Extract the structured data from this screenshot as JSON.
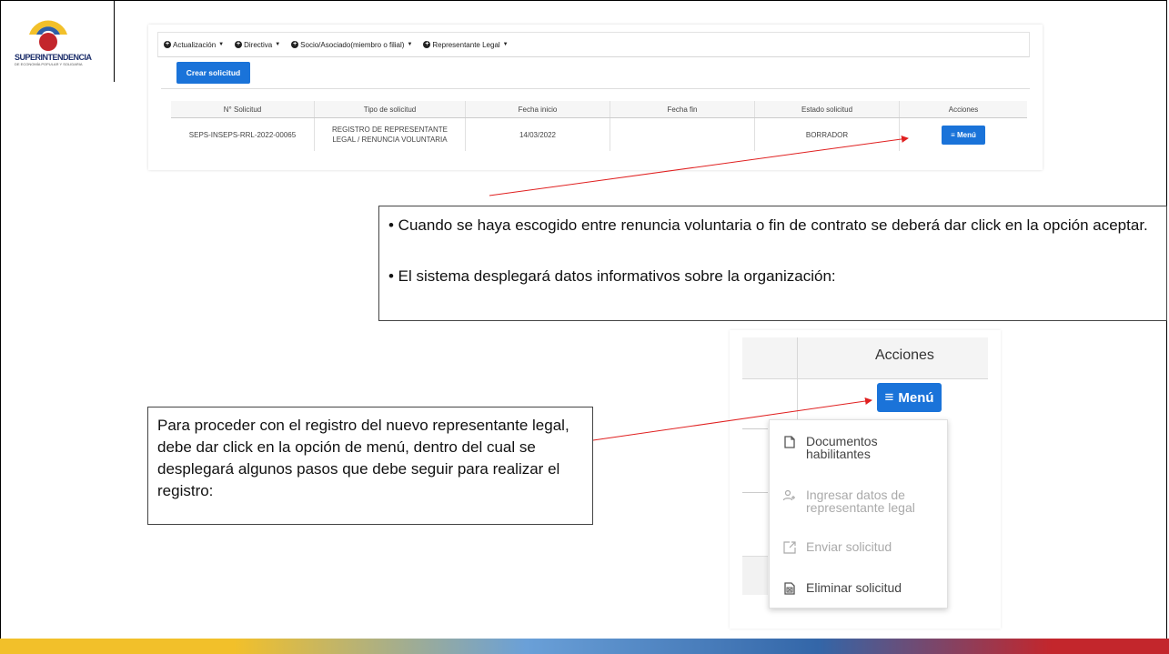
{
  "logo": {
    "text": "SUPERINTENDENCIA",
    "subtext": "DE ECONOMÍA POPULAR Y SOLIDARIA"
  },
  "top_screen": {
    "menu": [
      {
        "label": "Actualización"
      },
      {
        "label": "Directiva"
      },
      {
        "label": "Socio/Asociado(miembro o filial)"
      },
      {
        "label": "Representante Legal"
      }
    ],
    "crear_label": "Crear solicitud",
    "table": {
      "headers": [
        "N° Solicitud",
        "Tipo de solicitud",
        "Fecha inicio",
        "Fecha fin",
        "Estado solicitud",
        "Acciones"
      ],
      "row": {
        "numero": "SEPS-INSEPS-RRL-2022-00065",
        "tipo_line1": "REGISTRO DE REPRESENTANTE",
        "tipo_line2": "LEGAL / RENUNCIA VOLUNTARIA",
        "fecha_inicio": "14/03/2022",
        "fecha_fin": "",
        "estado": "BORRADOR",
        "accion": "≡ Menú"
      }
    }
  },
  "box1": {
    "p1": "• Cuando se haya escogido entre renuncia voluntaria o fin de contrato se deberá dar click en la opción aceptar.",
    "p2": "• El sistema desplegará datos informativos sobre la organización:"
  },
  "box2": {
    "text": "Para proceder con el registro del nuevo representante legal, debe dar click en la opción de menú, dentro del cual se desplegará algunos pasos que debe seguir para realizar el registro:"
  },
  "right_screen": {
    "acciones_label": "Acciones",
    "menu_label": "Menú",
    "dropdown": [
      {
        "line1": "Documentos",
        "line2": "habilitantes",
        "icon": "document-icon",
        "disabled": false
      },
      {
        "line1": "Ingresar datos de",
        "line2": "representante legal",
        "icon": "add-user-icon",
        "disabled": true
      },
      {
        "line1": "Enviar solicitud",
        "line2": "",
        "icon": "external-link-icon",
        "disabled": true
      },
      {
        "line1": "Eliminar solicitud",
        "line2": "",
        "icon": "excel-file-icon",
        "disabled": false
      }
    ]
  },
  "colors": {
    "accent": "#1a73d9",
    "arrow": "#e02020"
  }
}
